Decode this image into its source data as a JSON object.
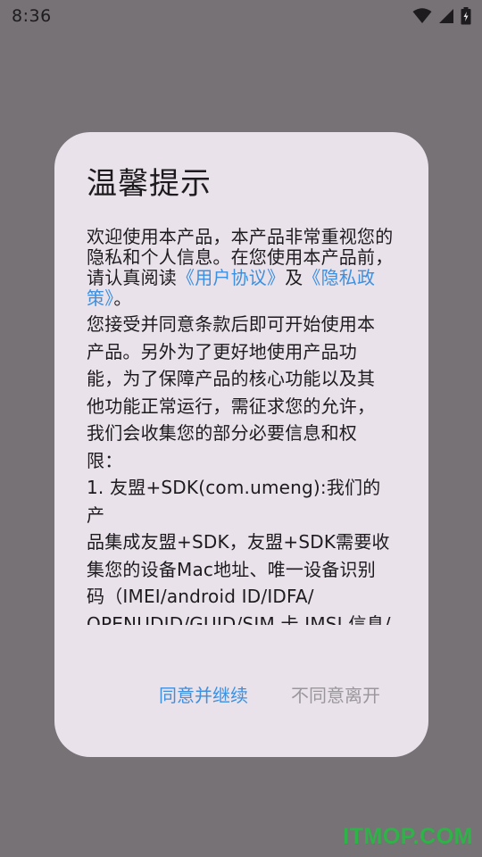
{
  "status_bar": {
    "time": "8:36",
    "icons": [
      "wifi-icon",
      "cell-signal-icon",
      "battery-icon"
    ]
  },
  "dialog": {
    "title": "温馨提示",
    "intro_prefix": "欢迎使用本产品，本产品非常重视您的隐私和个人信息。在您使用本产品前，请认真阅读",
    "user_agreement_link": "《用户协议》",
    "and_text": "及",
    "privacy_policy_link": "《隐私政策》",
    "intro_suffix": "。",
    "body_text": "您接受并同意条款后即可开始使用本\n产品。另外为了更好地使用产品功\n能，为了保障产品的核心功能以及其\n他功能正常运行，需征求您的允许，\n我们会收集您的部分必要信息和权\n限：\n1. 友盟+SDK(com.umeng):我们的产\n品集成友盟+SDK，友盟+SDK需要收\n集您的设备Mac地址、唯一设备识别\n码（IMEI/android ID/IDFA/\nOPENUDID/GUID/SIM 卡 IMSI 信息/\nICCID）以提供统计分析服务，并通",
    "agree_button": "同意并继续",
    "disagree_button": "不同意离开"
  },
  "watermark": "ITMOP.COM",
  "colors": {
    "scrim": "#767276",
    "dialog_bg": "#e9e2ea",
    "link": "#3d8fdf",
    "disabled_text": "#9a979c",
    "watermark": "#2fb247"
  }
}
